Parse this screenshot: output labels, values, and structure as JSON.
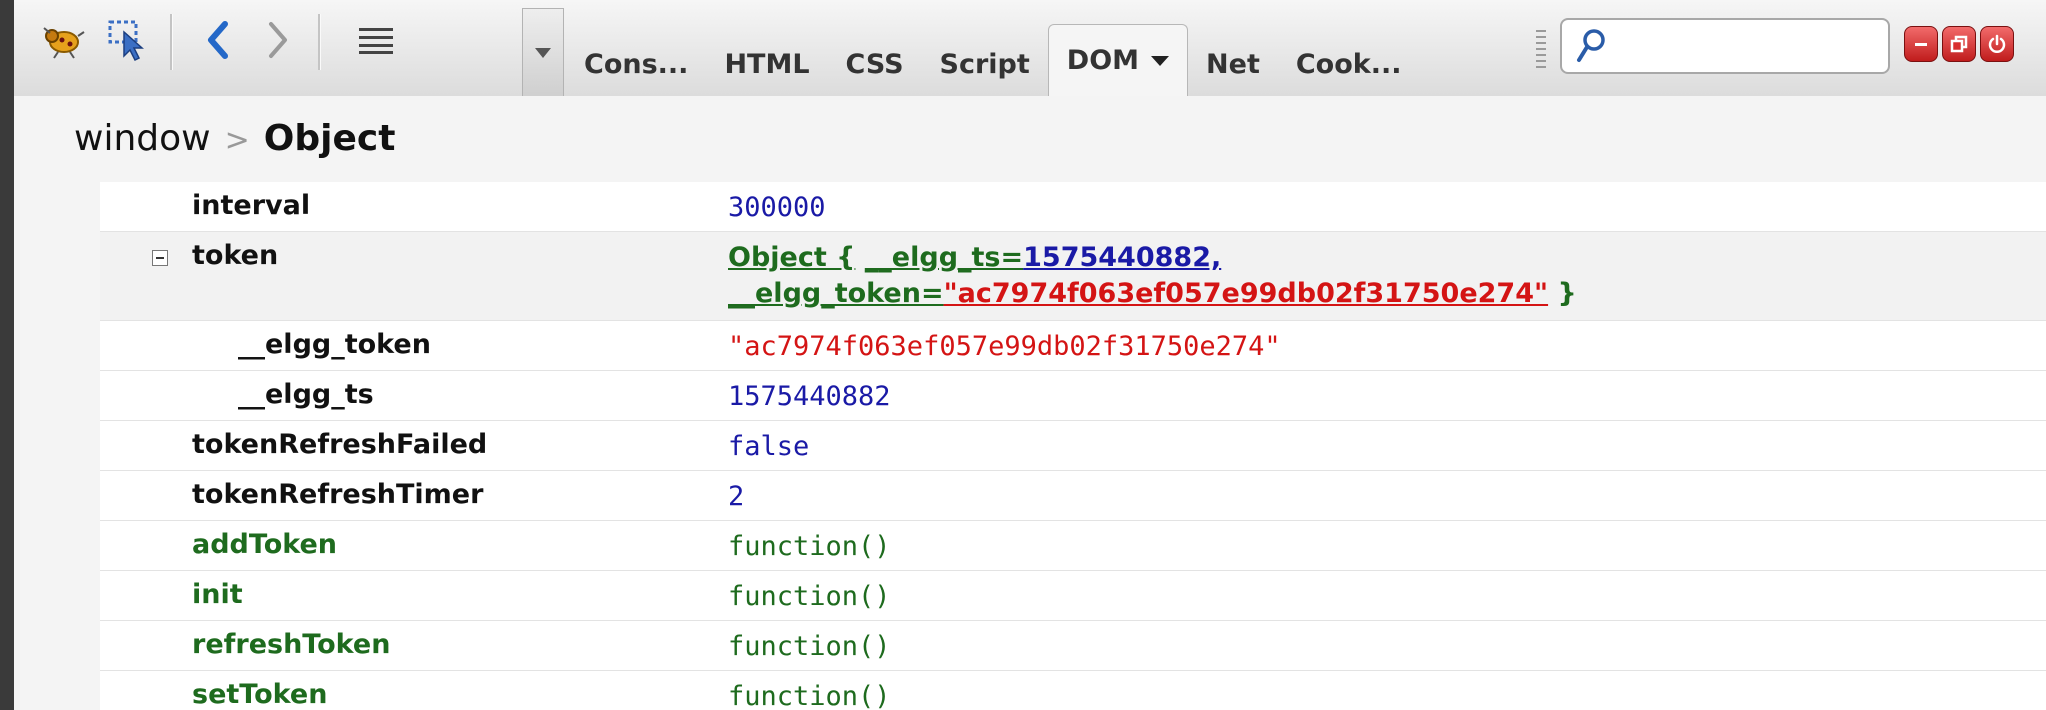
{
  "toolbar": {
    "tabs": [
      "Cons...",
      "HTML",
      "CSS",
      "Script",
      "DOM",
      "Net",
      "Cook..."
    ],
    "active_tab": "DOM",
    "search": {
      "value": "",
      "placeholder": ""
    }
  },
  "breadcrumb": {
    "root": "window",
    "separator": ">",
    "current": "Object"
  },
  "rows": {
    "interval": {
      "name": "interval",
      "value": "300000"
    },
    "token": {
      "name": "token",
      "summary": {
        "prefix": "Object {",
        "ts_key": "__elgg_ts=",
        "ts_value": "1575440882,",
        "token_key": "__elgg_token=",
        "token_value": "\"ac7974f063ef057e99db02f31750e274\"",
        "suffix": "}"
      }
    },
    "elgg_token": {
      "name": "__elgg_token",
      "value": "\"ac7974f063ef057e99db02f31750e274\""
    },
    "elgg_ts": {
      "name": "__elgg_ts",
      "value": "1575440882"
    },
    "tokenRefreshFailed": {
      "name": "tokenRefreshFailed",
      "value": "false"
    },
    "tokenRefreshTimer": {
      "name": "tokenRefreshTimer",
      "value": "2"
    },
    "addToken": {
      "name": "addToken",
      "value": "function()"
    },
    "init": {
      "name": "init",
      "value": "function()"
    },
    "refreshToken": {
      "name": "refreshToken",
      "value": "function()"
    },
    "setToken": {
      "name": "setToken",
      "value": "function()"
    }
  },
  "colors": {
    "number": "#1a1aa6",
    "string": "#d41414",
    "function": "#1e6b1e",
    "window_button": "#d9302f"
  },
  "icons": [
    "firebug-icon",
    "inspect-icon",
    "back-icon",
    "forward-icon",
    "panel-menu-icon",
    "tab-list-icon",
    "search-icon",
    "minimize-icon",
    "restore-icon",
    "close-icon"
  ]
}
